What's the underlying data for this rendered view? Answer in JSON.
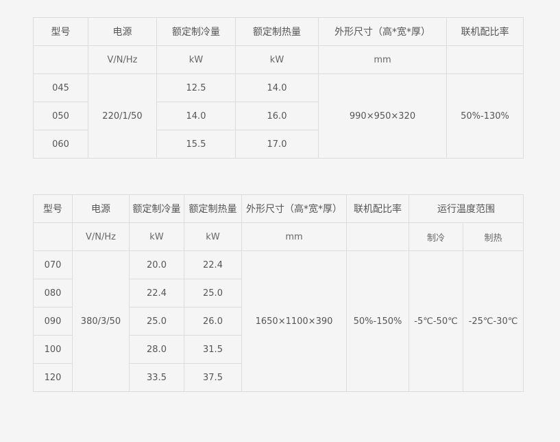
{
  "table_a": {
    "headers": [
      "型号",
      "电源",
      "额定制冷量",
      "额定制热量",
      "外形尺寸（高*宽*厚）",
      "联机配比率"
    ],
    "units": [
      "",
      "V/N/Hz",
      "kW",
      "kW",
      "mm",
      ""
    ],
    "power": "220/1/50",
    "dimensions": "990×950×320",
    "ratio": "50%-130%",
    "rows": [
      {
        "model": "045",
        "cooling": "12.5",
        "heating": "14.0"
      },
      {
        "model": "050",
        "cooling": "14.0",
        "heating": "16.0"
      },
      {
        "model": "060",
        "cooling": "15.5",
        "heating": "17.0"
      }
    ]
  },
  "table_b": {
    "headers": [
      "型号",
      "电源",
      "额定制冷量",
      "额定制热量",
      "外形尺寸（高*宽*厚）",
      "联机配比率",
      "运行温度范围"
    ],
    "units": [
      "",
      "V/N/Hz",
      "kW",
      "kW",
      "mm",
      "",
      "制冷",
      "制热"
    ],
    "power": "380/3/50",
    "dimensions": "1650×1100×390",
    "ratio": "50%-150%",
    "temp_cooling": "-5℃-50℃",
    "temp_heating": "-25℃-30℃",
    "rows": [
      {
        "model": "070",
        "cooling": "20.0",
        "heating": "22.4"
      },
      {
        "model": "080",
        "cooling": "22.4",
        "heating": "25.0"
      },
      {
        "model": "090",
        "cooling": "25.0",
        "heating": "26.0"
      },
      {
        "model": "100",
        "cooling": "28.0",
        "heating": "31.5"
      },
      {
        "model": "120",
        "cooling": "33.5",
        "heating": "37.5"
      }
    ]
  }
}
